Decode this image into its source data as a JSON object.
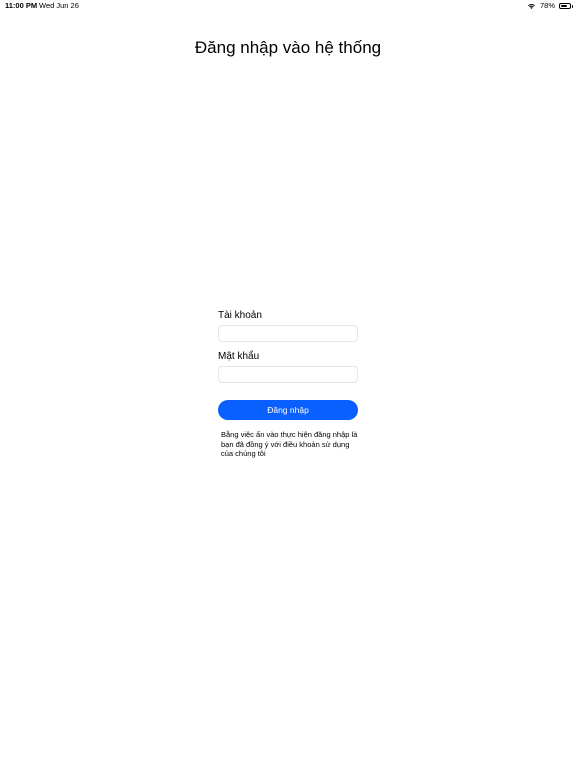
{
  "status_bar": {
    "time": "11:00 PM",
    "date": "Wed Jun 26",
    "battery_percent": "78%",
    "battery_level": 0.78,
    "wifi_icon": "wifi-icon",
    "battery_icon": "battery-icon"
  },
  "page": {
    "title": "Đăng nhập vào hệ thống"
  },
  "form": {
    "username_label": "Tài khoản",
    "username_value": "",
    "password_label": "Mật khẩu",
    "password_value": "",
    "login_button_label": "Đăng nhập",
    "terms_text": "Bằng việc ấn vào thực hiện đăng nhập là bạn đã đồng ý với điều khoản sử dụng của chúng tôi"
  },
  "colors": {
    "accent": "#0a60ff",
    "background": "#ffffff",
    "field_border": "#e6e6e6"
  }
}
